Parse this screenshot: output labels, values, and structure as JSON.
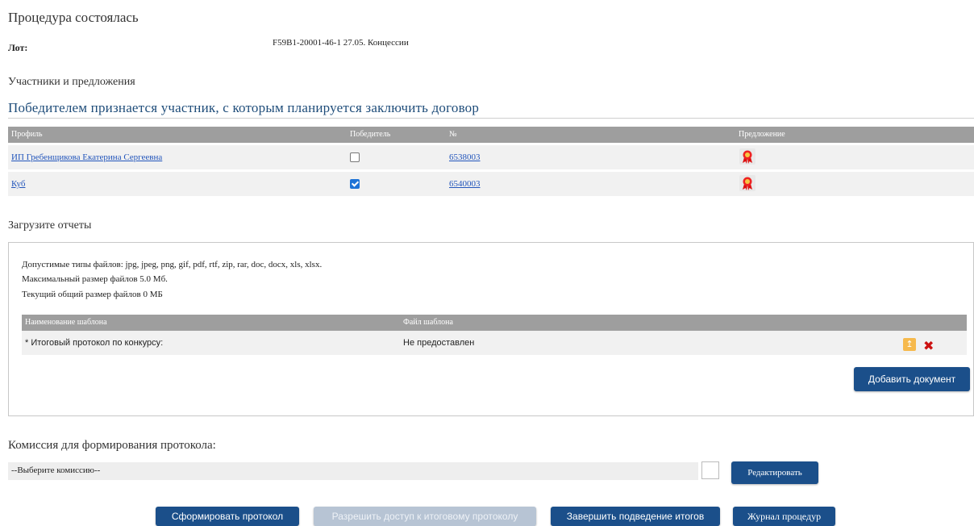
{
  "procedure": {
    "title": "Процедура состоялась",
    "lot_label": "Лот:",
    "lot_value": "F59B1-20001-46-1 27.05. Концессии"
  },
  "participants": {
    "section_label": "Участники и предложения",
    "winner_notice": "Победителем признается участник, с которым планируется заключить договор",
    "columns": [
      "Профиль",
      "Победитель",
      "№",
      "Предложение"
    ],
    "rows": [
      {
        "profile": "ИП Гребенщикова Екатерина Сергеевна",
        "winner": false,
        "number": "6538003",
        "offer_icon": "ribbon-award-icon"
      },
      {
        "profile": "Куб",
        "winner": true,
        "number": "6540003",
        "offer_icon": "ribbon-award-icon"
      }
    ]
  },
  "reports": {
    "section_label": "Загрузите отчеты",
    "allowed_types": "Допустимые типы файлов: jpg, jpeg, png, gif, pdf, rtf, zip, rar, doc, docx, xls, xlsx.",
    "max_size": "Максимальный размер файлов 5.0 Мб.",
    "current_size": "Текущий общий размер файлов  0 МБ",
    "columns": [
      "Наименование шаблона",
      "Файл шаблона"
    ],
    "rows": [
      {
        "name": "* Итоговый протокол по конкурсу:",
        "file": "Не предоставлен"
      }
    ],
    "add_button": "Добавить документ"
  },
  "commission": {
    "label": "Комиссия для формирования протокола:",
    "select_value": "--Выберите комиссию--",
    "edit_button": "Редактировать"
  },
  "actions": {
    "form_protocol": "Сформировать протокол",
    "allow_access": "Разрешить доступ к итоговому протоколу",
    "finish_results": "Завершить подведение итогов",
    "journal": "Журнал процедур"
  },
  "colors": {
    "primary_button": "#1b4f8a",
    "header_gray": "#9e9e9e",
    "link": "#2255bb",
    "checkbox_checked": "#1e73d6",
    "delete_red": "#cc1111"
  }
}
